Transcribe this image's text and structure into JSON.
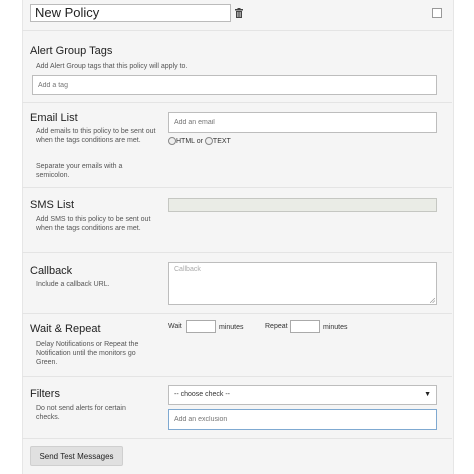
{
  "policy": {
    "name": "New Policy"
  },
  "alert_group_tags": {
    "heading": "Alert Group Tags",
    "help": "Add Alert Group tags that this policy will apply to.",
    "placeholder": "Add a tag"
  },
  "email_list": {
    "heading": "Email List",
    "help1": "Add emails to this policy to be sent out when the tags conditions are met.",
    "help2": "Separate your emails with a semicolon.",
    "placeholder": "Add an email",
    "format_html": "HTML or",
    "format_text": "TEXT"
  },
  "sms_list": {
    "heading": "SMS List",
    "help": "Add SMS to this policy to be sent out when the tags conditions are met."
  },
  "callback": {
    "heading": "Callback",
    "help": "Include a callback URL.",
    "placeholder": "Callback"
  },
  "wait_repeat": {
    "heading": "Wait & Repeat",
    "help": "Delay Notifications or Repeat the Notification until the monitors go Green.",
    "wait_label": "Wait",
    "repeat_label": "Repeat",
    "unit1": "minutes",
    "unit2": "minutes"
  },
  "filters": {
    "heading": "Filters",
    "help": "Do not send alerts for certain checks.",
    "select_value": "-- choose check --",
    "exclusion_placeholder": "Add an exclusion"
  },
  "actions": {
    "send_test": "Send Test Messages"
  }
}
